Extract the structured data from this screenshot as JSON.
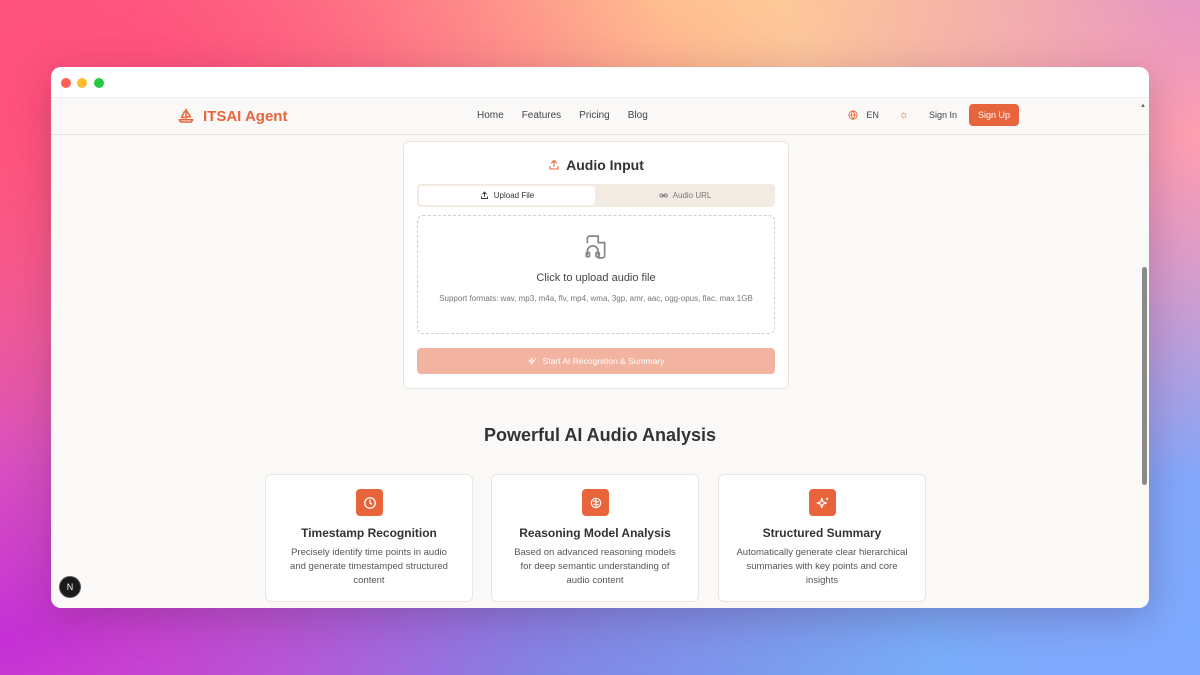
{
  "brand": {
    "name": "ITSAI Agent"
  },
  "nav": {
    "links": [
      "Home",
      "Features",
      "Pricing",
      "Blog"
    ],
    "language": "EN",
    "signin": "Sign In",
    "signup": "Sign Up"
  },
  "audio_input": {
    "title": "Audio Input",
    "tabs": [
      "Upload File",
      "Audio URL"
    ],
    "active_tab": "Upload File",
    "dropzone_title": "Click to upload audio file",
    "dropzone_formats": "Support formats: wav, mp3, m4a, flv, mp4, wma, 3gp, amr, aac, ogg-opus, flac, max 1GB",
    "start_button": "Start AI Recognition & Summary"
  },
  "section": {
    "title": "Powerful AI Audio Analysis"
  },
  "features": [
    {
      "title": "Timestamp Recognition",
      "desc": "Precisely identify time points in audio and generate timestamped structured content",
      "icon": "clock-icon"
    },
    {
      "title": "Reasoning Model Analysis",
      "desc": "Based on advanced reasoning models for deep semantic understanding of audio content",
      "icon": "brain-icon"
    },
    {
      "title": "Structured Summary",
      "desc": "Automatically generate clear hierarchical summaries with key points and core insights",
      "icon": "sparkles-icon"
    }
  ],
  "badge": {
    "label": "N"
  },
  "colors": {
    "accent": "#e8643a",
    "accent_light": "#f2b3a0",
    "page_bg": "#fbf9f7"
  }
}
